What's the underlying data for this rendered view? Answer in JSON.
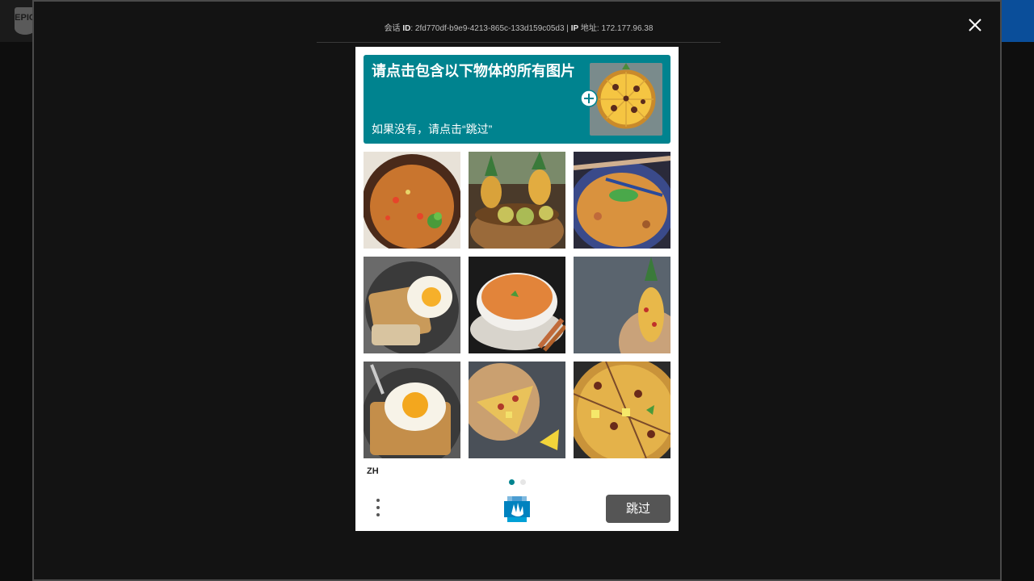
{
  "background": {
    "logo_text": "EPIC"
  },
  "session": {
    "id_prefix": "会话",
    "id_label": "ID",
    "id_value": "2fd770df-b9e9-4213-865c-133d159c05d3",
    "separator": "|",
    "ip_label": "IP",
    "ip_suffix": "地址",
    "ip_value": "172.177.96.38"
  },
  "captcha": {
    "prompt_title": "请点击包含以下物体的所有图片",
    "prompt_subtitle": "如果没有，请点击“跳过”",
    "language": "ZH",
    "submit_label": "跳过",
    "accent_color": "#00838f",
    "tiles": [
      {
        "name": "tile-vegetable-soup-bowl"
      },
      {
        "name": "tile-pineapple-basket"
      },
      {
        "name": "tile-soup-with-chopsticks"
      },
      {
        "name": "tile-egg-on-toast"
      },
      {
        "name": "tile-orange-soup-bowl"
      },
      {
        "name": "tile-pineapple-slice"
      },
      {
        "name": "tile-egg-toast-fork"
      },
      {
        "name": "tile-pineapple-pizza-slice"
      },
      {
        "name": "tile-pineapple-pizza"
      }
    ],
    "page_dots": [
      {
        "active": true
      },
      {
        "active": false
      }
    ]
  }
}
